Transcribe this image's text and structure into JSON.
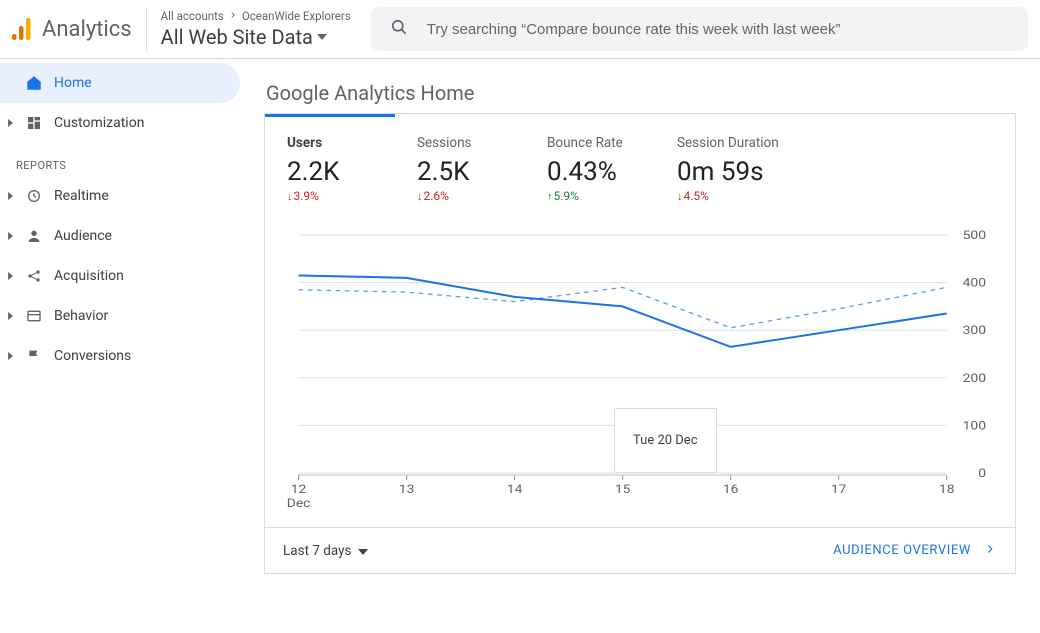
{
  "header": {
    "brand": "Analytics",
    "breadcrumbs": {
      "all_accounts": "All accounts",
      "account": "OceanWide Explorers"
    },
    "view_name": "All Web Site Data",
    "search_placeholder": "Try searching “Compare bounce rate this week with last week”"
  },
  "sidebar": {
    "home": "Home",
    "customization": "Customization",
    "reports_label": "REPORTS",
    "realtime": "Realtime",
    "audience": "Audience",
    "acquisition": "Acquisition",
    "behavior": "Behavior",
    "conversions": "Conversions"
  },
  "page": {
    "title": "Google Analytics Home"
  },
  "metrics": [
    {
      "label": "Users",
      "value": "2.2K",
      "delta": "3.9%",
      "dir": "down"
    },
    {
      "label": "Sessions",
      "value": "2.5K",
      "delta": "2.6%",
      "dir": "down"
    },
    {
      "label": "Bounce Rate",
      "value": "0.43%",
      "delta": "5.9%",
      "dir": "up"
    },
    {
      "label": "Session Duration",
      "value": "0m 59s",
      "delta": "4.5%",
      "dir": "down"
    }
  ],
  "footer": {
    "range": "Last 7 days",
    "overview": "AUDIENCE OVERVIEW"
  },
  "tooltip": "Tue 20 Dec",
  "chart_data": {
    "type": "line",
    "x": [
      "12",
      "13",
      "14",
      "15",
      "16",
      "17",
      "18"
    ],
    "x_month": "Dec",
    "ylim": [
      0,
      500
    ],
    "y_ticks": [
      0,
      100,
      200,
      300,
      400,
      500
    ],
    "series": [
      {
        "name": "current",
        "style": "solid",
        "values": [
          415,
          410,
          370,
          350,
          265,
          300,
          335
        ]
      },
      {
        "name": "previous",
        "style": "dashed",
        "values": [
          385,
          380,
          360,
          390,
          305,
          345,
          390
        ]
      }
    ]
  }
}
